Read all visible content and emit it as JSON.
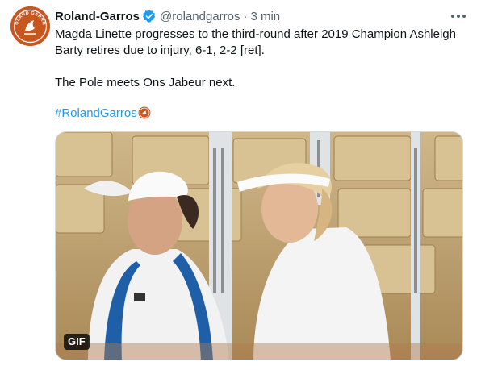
{
  "tweet": {
    "display_name": "Roland-Garros",
    "handle": "@rolandgarros",
    "separator": "·",
    "time": "3 min",
    "text_line1": "Magda Linette progresses to the third-round after 2019 Champion Ashleigh Barty retires due to injury, 6-1, 2-2 [ret].",
    "text_line2": "The Pole meets Ons Jabeur next.",
    "hashtag": "#RolandGarros",
    "avatar_text": "ROLAND GARROS",
    "media_badge": "GIF"
  },
  "icons": {
    "verified": "verified-badge-icon",
    "more": "more-options-icon",
    "hashtag_emoji": "roland-garros-emoji-icon"
  },
  "colors": {
    "accent": "#1d9bf0",
    "brand": "#c8561f",
    "text": "#0f1419",
    "muted": "#536471"
  }
}
